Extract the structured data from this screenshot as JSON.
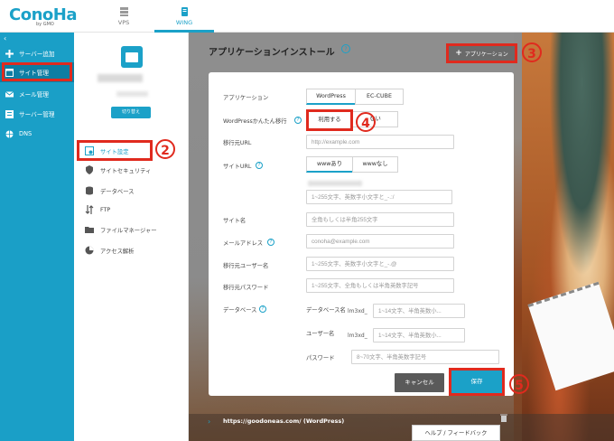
{
  "topbar": {
    "logo": "ConoHa",
    "logo_sub": "by GMO",
    "tabs": [
      {
        "label": "VPS"
      },
      {
        "label": "WING"
      }
    ]
  },
  "sidebar": {
    "collapse": "‹",
    "items": [
      {
        "label": "サーバー追加",
        "icon": "plus-icon"
      },
      {
        "label": "サイト管理",
        "icon": "site-icon"
      },
      {
        "label": "メール管理",
        "icon": "mail-icon"
      },
      {
        "label": "サーバー管理",
        "icon": "server-icon"
      },
      {
        "label": "DNS",
        "icon": "globe-icon"
      }
    ]
  },
  "subside": {
    "switch_label": "切り替え",
    "items": [
      {
        "label": "サイト設定",
        "icon": "site-settings-icon"
      },
      {
        "label": "サイトセキュリティ",
        "icon": "shield-icon"
      },
      {
        "label": "データベース",
        "icon": "database-icon"
      },
      {
        "label": "FTP",
        "icon": "ftp-icon"
      },
      {
        "label": "ファイルマネージャー",
        "icon": "folder-icon"
      },
      {
        "label": "アクセス解析",
        "icon": "pie-chart-icon"
      }
    ]
  },
  "main": {
    "title": "アプリケーションインストール",
    "help": "?",
    "app_button": "アプリケーション",
    "app_button_plus": "+"
  },
  "form": {
    "application_label": "アプリケーション",
    "application_options": [
      "WordPress",
      "EC-CUBE"
    ],
    "migrate_label": "WordPressかんたん移行",
    "migrate_use": "利用する",
    "migrate_no_suffix": "ない",
    "source_url_label": "移行元URL",
    "source_url_placeholder": "http://example.com",
    "site_url_label": "サイトURL",
    "www_options": [
      "wwwあり",
      "wwwなし"
    ],
    "path_placeholder": "1~255文字、英数字小文字と_-.:/",
    "site_name_label": "サイト名",
    "site_name_placeholder": "全角もしくは半角255文字",
    "email_label": "メールアドレス",
    "email_placeholder": "conoha@example.com",
    "source_user_label": "移行元ユーザー名",
    "source_user_placeholder": "1~255文字、英数字小文字と_-.@",
    "source_password_label": "移行元パスワード",
    "source_password_placeholder": "1~255文字、全角もしくは半角英数字記号",
    "database_label": "データベース",
    "db_name_label": "データベース名",
    "db_prefix": "lm3xd_",
    "db_name_placeholder": "1~14文字、半角英数小...",
    "db_user_label": "ユーザー名",
    "db_user_placeholder": "1~14文字、半角英数小...",
    "db_password_label": "パスワード",
    "db_password_placeholder": "8~70文字、半角英数字記号",
    "cancel_label": "キャンセル",
    "save_label": "保存"
  },
  "bottom": {
    "chevron": "›",
    "url": "https://goodoneas.com/ (WordPress)",
    "help_feedback": "ヘルプ / フィードバック"
  },
  "markers": [
    "1",
    "2",
    "3",
    "4",
    "5"
  ],
  "colors": {
    "accent": "#1ba1c8",
    "annotation_red": "#e02a1e"
  }
}
